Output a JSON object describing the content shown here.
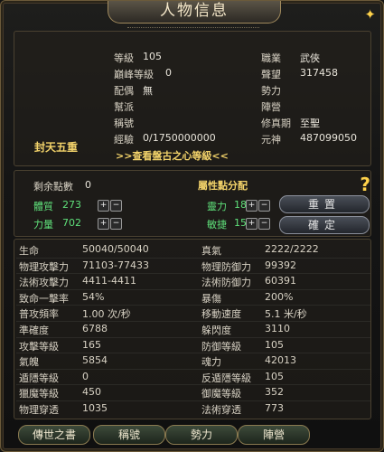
{
  "title": "人物信息",
  "realm": "封天五重",
  "pangu_link": ">>查看盤古之心等級<<",
  "info_left": [
    {
      "label": "等級",
      "value": "105"
    },
    {
      "label": "巔峰等級",
      "value": "0"
    },
    {
      "label": "配偶",
      "value": "無"
    },
    {
      "label": "幫派",
      "value": ""
    },
    {
      "label": "稱號",
      "value": ""
    },
    {
      "label": "經驗",
      "value": "0/1750000000"
    }
  ],
  "info_right": [
    {
      "label": "職業",
      "value": "武俠"
    },
    {
      "label": "聲望",
      "value": "317458"
    },
    {
      "label": "勢力",
      "value": ""
    },
    {
      "label": "陣營",
      "value": ""
    },
    {
      "label": "修真期",
      "value": "至聖"
    },
    {
      "label": "元神",
      "value": "487099050"
    }
  ],
  "points": {
    "remaining_label": "剩余點數",
    "remaining_value": "0",
    "section_title": "屬性點分配",
    "attrs": [
      {
        "label": "體質",
        "value": "273"
      },
      {
        "label": "靈力",
        "value": "18"
      },
      {
        "label": "力量",
        "value": "702"
      },
      {
        "label": "敏捷",
        "value": "150"
      }
    ],
    "reset_label": "重置",
    "confirm_label": "確定"
  },
  "stats_left": [
    {
      "label": "生命",
      "value": "50040/50040"
    },
    {
      "label": "物理攻擊力",
      "value": "71103-77433"
    },
    {
      "label": "法術攻擊力",
      "value": "4411-4411"
    },
    {
      "label": "致命一擊率",
      "value": "54%"
    },
    {
      "label": "普攻頻率",
      "value": "1.00 次/秒"
    },
    {
      "label": "準確度",
      "value": "6788"
    },
    {
      "label": "攻擊等級",
      "value": "165"
    },
    {
      "label": "氣魄",
      "value": "5854"
    },
    {
      "label": "遁隱等級",
      "value": "0"
    },
    {
      "label": "獵魔等級",
      "value": "450"
    },
    {
      "label": "物理穿透",
      "value": "1035"
    }
  ],
  "stats_right": [
    {
      "label": "真氣",
      "value": "2222/2222"
    },
    {
      "label": "物理防御力",
      "value": "99392"
    },
    {
      "label": "法術防御力",
      "value": "60391"
    },
    {
      "label": "暴傷",
      "value": "200%"
    },
    {
      "label": "移動速度",
      "value": "5.1 米/秒"
    },
    {
      "label": "躲閃度",
      "value": "3110"
    },
    {
      "label": "防御等級",
      "value": "105"
    },
    {
      "label": "魂力",
      "value": "42013"
    },
    {
      "label": "反遁隱等級",
      "value": "105"
    },
    {
      "label": "御魔等級",
      "value": "352"
    },
    {
      "label": "法術穿透",
      "value": "773"
    }
  ],
  "tabs": [
    "傳世之書",
    "稱號",
    "勢力",
    "陣營"
  ],
  "plus_symbol": "+",
  "minus_symbol": "−",
  "close_symbol": "✦",
  "help_symbol": "?"
}
